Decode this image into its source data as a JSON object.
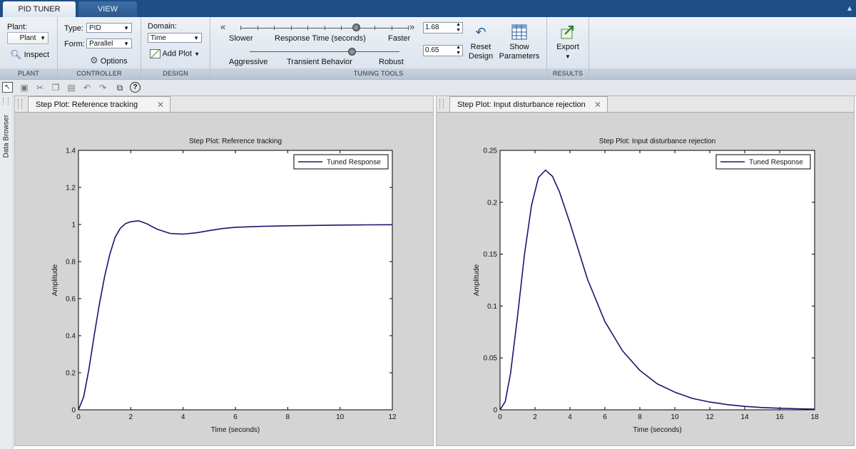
{
  "tabs": {
    "pid_tuner": "PID TUNER",
    "view": "VIEW"
  },
  "plant": {
    "label": "Plant:",
    "value": "Plant",
    "inspect": "Inspect",
    "section": "PLANT"
  },
  "controller": {
    "type_label": "Type:",
    "type_value": "PID",
    "form_label": "Form:",
    "form_value": "Parallel",
    "options": "Options",
    "section": "CONTROLLER"
  },
  "design": {
    "domain_label": "Domain:",
    "domain_value": "Time",
    "add_plot": "Add Plot",
    "section": "DESIGN"
  },
  "tuning": {
    "slower": "Slower",
    "response_time": "Response Time (seconds)",
    "faster": "Faster",
    "aggressive": "Aggressive",
    "transient": "Transient Behavior",
    "robust": "Robust",
    "response_value": "1.68",
    "transient_value": "0.65",
    "response_slider": 0.69,
    "transient_slider": 0.68,
    "reset": "Reset",
    "reset2": "Design",
    "show": "Show",
    "show2": "Parameters",
    "section": "TUNING TOOLS"
  },
  "results": {
    "export": "Export",
    "section": "RESULTS"
  },
  "side": {
    "data_browser": "Data Browser"
  },
  "plots": [
    {
      "tab": "Step Plot: Reference tracking"
    },
    {
      "tab": "Step Plot: Input disturbance rejection"
    }
  ],
  "colors": {
    "ribbon_blue": "#1f4e86",
    "line": "#16166e",
    "plot_bg": "#d4d4d4"
  },
  "chart_data": [
    {
      "type": "line",
      "title": "Step Plot: Reference tracking",
      "xlabel": "Time (seconds)",
      "ylabel": "Amplitude",
      "xlim": [
        0,
        12
      ],
      "ylim": [
        0,
        1.4
      ],
      "xticks": [
        0,
        2,
        4,
        6,
        8,
        10,
        12
      ],
      "yticks": [
        0,
        0.2,
        0.4,
        0.6,
        0.8,
        1,
        1.2,
        1.4
      ],
      "legend": "top-right",
      "series": [
        {
          "name": "Tuned Response",
          "x": [
            0,
            0.2,
            0.4,
            0.6,
            0.8,
            1.0,
            1.2,
            1.4,
            1.6,
            1.8,
            2.0,
            2.3,
            2.6,
            3.0,
            3.5,
            4.0,
            4.5,
            5.0,
            5.5,
            6.0,
            7.0,
            8.0,
            9.0,
            10.0,
            11.0,
            12.0
          ],
          "y": [
            0,
            0.07,
            0.22,
            0.4,
            0.57,
            0.72,
            0.84,
            0.93,
            0.98,
            1.005,
            1.015,
            1.02,
            1.005,
            0.975,
            0.952,
            0.948,
            0.955,
            0.967,
            0.978,
            0.985,
            0.99,
            0.993,
            0.995,
            0.997,
            0.998,
            0.999
          ]
        }
      ]
    },
    {
      "type": "line",
      "title": "Step Plot: Input disturbance rejection",
      "xlabel": "Time (seconds)",
      "ylabel": "Amplitude",
      "xlim": [
        0,
        18
      ],
      "ylim": [
        0,
        0.25
      ],
      "xticks": [
        0,
        2,
        4,
        6,
        8,
        10,
        12,
        14,
        16,
        18
      ],
      "yticks": [
        0,
        0.05,
        0.1,
        0.15,
        0.2,
        0.25
      ],
      "legend": "top-right",
      "series": [
        {
          "name": "Tuned Response",
          "x": [
            0,
            0.3,
            0.6,
            1.0,
            1.4,
            1.8,
            2.2,
            2.6,
            3.0,
            3.4,
            4.0,
            5.0,
            6.0,
            7.0,
            8.0,
            9.0,
            10.0,
            11.0,
            12.0,
            13.0,
            14.0,
            15.0,
            16.0,
            17.0,
            18.0
          ],
          "y": [
            0,
            0.008,
            0.035,
            0.09,
            0.15,
            0.197,
            0.224,
            0.231,
            0.225,
            0.21,
            0.18,
            0.126,
            0.085,
            0.057,
            0.038,
            0.025,
            0.017,
            0.011,
            0.0075,
            0.005,
            0.0033,
            0.0022,
            0.0015,
            0.001,
            0.0007
          ]
        }
      ]
    }
  ]
}
